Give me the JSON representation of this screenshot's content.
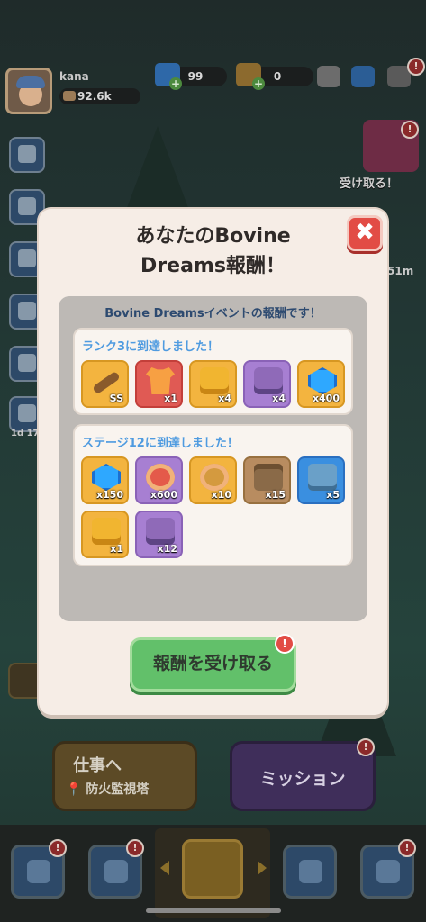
{
  "player": {
    "name": "kana",
    "money": "92.6k"
  },
  "resources": [
    {
      "name": "gem",
      "value": "99",
      "color": "#2e68a8"
    },
    {
      "name": "ticket",
      "value": "0",
      "color": "#8c6a2e"
    }
  ],
  "side": {
    "gift_label": "受け取る！",
    "timer": "51m",
    "day_label": "1d 17"
  },
  "modal": {
    "title_line1": "あなたのBovine",
    "title_line2": "Dreams報酬！",
    "close_icon": "✖",
    "panel_header": "Bovine Dreamsイベントの報酬です！",
    "groups": [
      {
        "label": "ランク3に到達しました！",
        "items": [
          {
            "icon": "tool",
            "style": "gold",
            "qty": "SS"
          },
          {
            "icon": "shirt",
            "style": "red",
            "qty": "x1"
          },
          {
            "icon": "pack",
            "style": "gold",
            "qty": "x4"
          },
          {
            "icon": "pack-violet",
            "style": "purple",
            "qty": "x4"
          },
          {
            "icon": "gem",
            "style": "gold",
            "qty": "x400"
          }
        ]
      },
      {
        "label": "ステージ12に到達しました！",
        "items": [
          {
            "icon": "gem",
            "style": "gold",
            "qty": "x150"
          },
          {
            "icon": "roll",
            "style": "purple",
            "qty": "x600"
          },
          {
            "icon": "roll-tan",
            "style": "gold",
            "qty": "x10"
          },
          {
            "icon": "chest",
            "style": "brown",
            "qty": "x15"
          },
          {
            "icon": "suitcase",
            "style": "blue",
            "qty": "x5"
          },
          {
            "icon": "pack",
            "style": "gold",
            "qty": "x1"
          },
          {
            "icon": "pack-violet",
            "style": "purple",
            "qty": "x12"
          }
        ]
      }
    ],
    "claim_label": "報酬を受け取る"
  },
  "buttons": {
    "work_title": "仕事へ",
    "work_location": "防火監視塔",
    "mission_label": "ミッション"
  },
  "colors": {
    "modal_bg": "#f6ede6",
    "claim_green": "#62c06a",
    "close_red": "#e24c45",
    "accent_blue": "#4f9be0"
  }
}
